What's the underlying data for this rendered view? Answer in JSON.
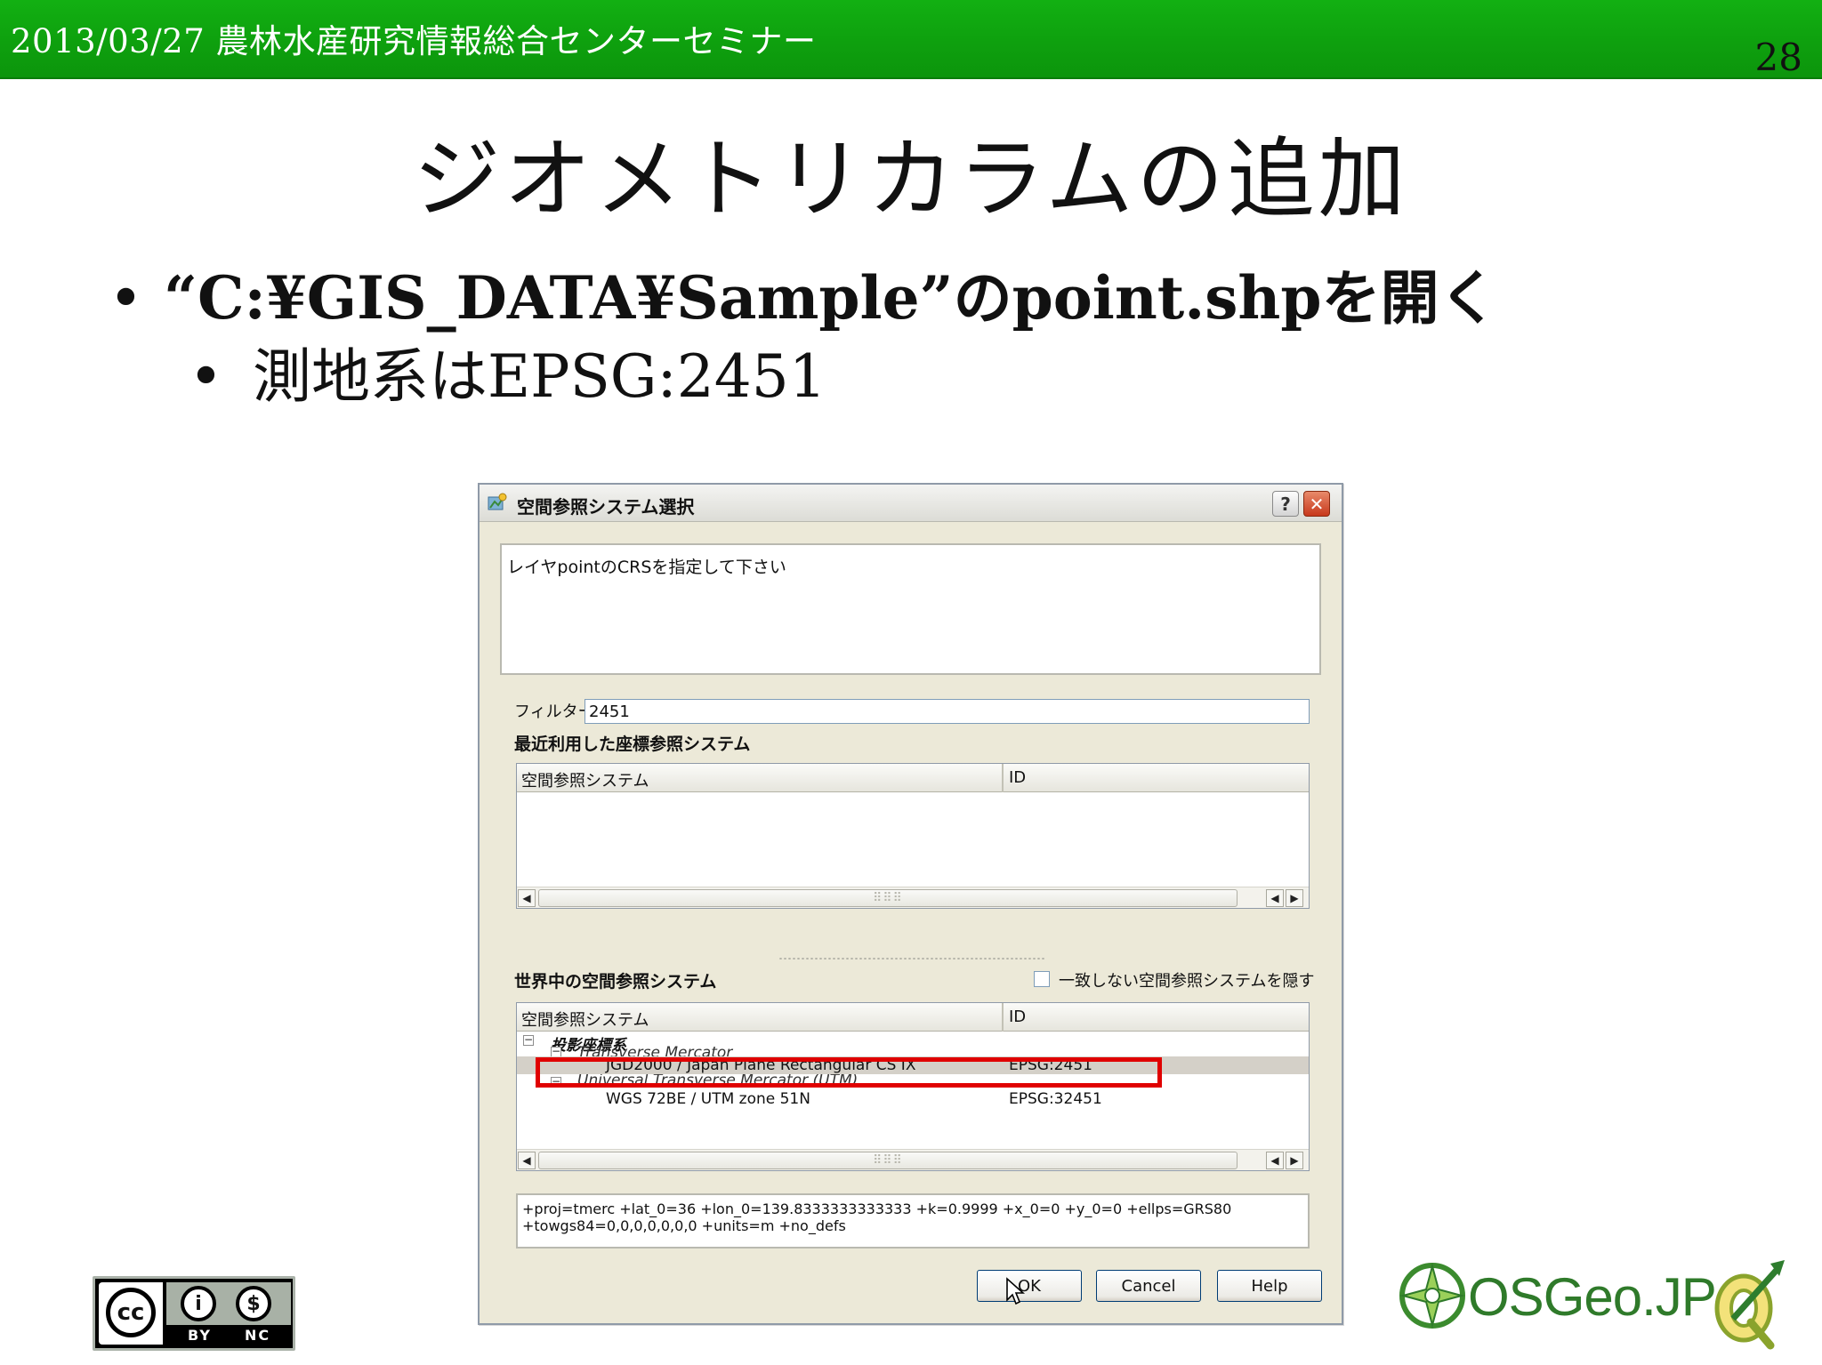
{
  "slide": {
    "header": "2013/03/27 農林水産研究情報総合センターセミナー",
    "page_number": "28",
    "title": "ジオメトリカラムの追加",
    "bullets": [
      "“C:¥GIS_DATA¥Sample”のpoint.shpを開く",
      "測地系はEPSG:2451"
    ]
  },
  "dialog": {
    "title": "空間参照システム選択",
    "help_button": "?",
    "close_button": "✕",
    "message": "レイヤpointのCRSを指定して下さい",
    "filter_label": "フィルター",
    "filter_value": "2451",
    "recent_label": "最近利用した座標参照システム",
    "recent_columns": [
      "空間参照システム",
      "ID"
    ],
    "world_label": "世界中の空間参照システム",
    "hide_checkbox_label": "一致しない空間参照システムを隠す",
    "world_columns": [
      "空間参照システム",
      "ID"
    ],
    "tree": [
      {
        "text": "投影座標系",
        "id": ""
      },
      {
        "text": "Transverse Mercator",
        "id": ""
      },
      {
        "text": "JGD2000 / Japan Plane Rectangular CS IX",
        "id": "EPSG:2451"
      },
      {
        "text": "Universal Transverse Mercator (UTM)",
        "id": ""
      },
      {
        "text": "WGS 72BE / UTM zone 51N",
        "id": "EPSG:32451"
      }
    ],
    "proj_lines": [
      "+proj=tmerc +lat_0=36 +lon_0=139.8333333333333 +k=0.9999 +x_0=0 +y_0=0 +ellps=GRS80",
      "+towgs84=0,0,0,0,0,0,0 +units=m +no_defs"
    ],
    "buttons": {
      "ok": "OK",
      "cancel": "Cancel",
      "help": "Help"
    },
    "scroll_left": "◀",
    "scroll_right": "▶",
    "scroll_grip": "⠿⠿⠿"
  },
  "logos": {
    "cc_symbol": "cc",
    "cc_by": "BY",
    "cc_nc": "NC",
    "osgeo_text": "OSGeo.JP"
  },
  "colors": {
    "header_green": "#0ea00e",
    "highlight_red": "#e00000"
  },
  "icons": [
    "qgis-app-icon",
    "help-icon",
    "close-icon",
    "cc-icon",
    "by-icon",
    "nc-icon",
    "osgeo-icon",
    "qgis-logo-icon"
  ]
}
